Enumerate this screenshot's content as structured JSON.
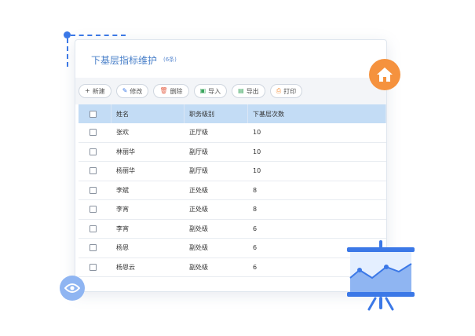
{
  "panel": {
    "title": "下基层指标维护",
    "subtitle": "(6条)"
  },
  "toolbar": {
    "buttons": [
      {
        "label": "新建",
        "icon": "plus-icon"
      },
      {
        "label": "修改",
        "icon": "edit-icon"
      },
      {
        "label": "删除",
        "icon": "trash-icon"
      },
      {
        "label": "导入",
        "icon": "import-icon"
      },
      {
        "label": "导出",
        "icon": "export-icon"
      },
      {
        "label": "打印",
        "icon": "print-icon"
      }
    ]
  },
  "table": {
    "headers": {
      "name": "姓名",
      "level": "职务级别",
      "count": "下基层次数"
    },
    "rows": [
      {
        "name": "张欢",
        "level": "正厅级",
        "count": "10"
      },
      {
        "name": "林丽华",
        "level": "副厅级",
        "count": "10"
      },
      {
        "name": "杨丽华",
        "level": "副厅级",
        "count": "10"
      },
      {
        "name": "李斌",
        "level": "正处级",
        "count": "8"
      },
      {
        "name": "李宵",
        "level": "正处级",
        "count": "8"
      },
      {
        "name": "李宵",
        "level": "副处级",
        "count": "6"
      },
      {
        "name": "杨恩",
        "level": "副处级",
        "count": "6"
      },
      {
        "name": "杨恩云",
        "level": "副处级",
        "count": "6"
      }
    ]
  },
  "colors": {
    "accent": "#3b78e7",
    "header_bg": "#c3dcf5",
    "home_badge": "#f5923e",
    "eye_badge": "#8fb5f2"
  }
}
